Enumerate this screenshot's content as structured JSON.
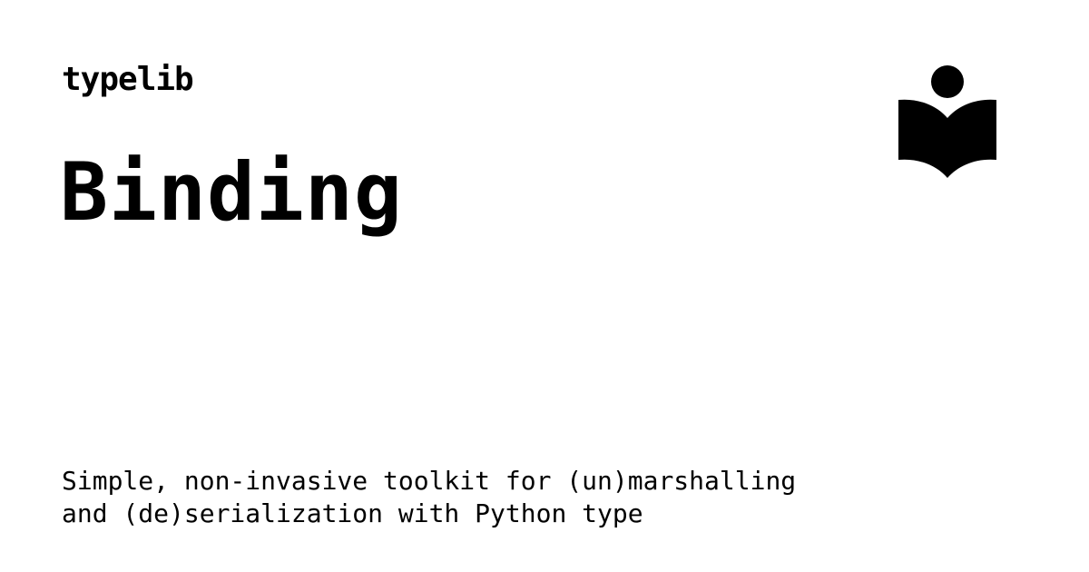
{
  "header": {
    "site_name": "typelib",
    "logo_icon": "reader-book-icon"
  },
  "main": {
    "title": "Binding",
    "description": "Simple, non-invasive toolkit for (un)marshalling\nand (de)serialization with Python type"
  },
  "colors": {
    "background": "#ffffff",
    "text": "#000000"
  }
}
